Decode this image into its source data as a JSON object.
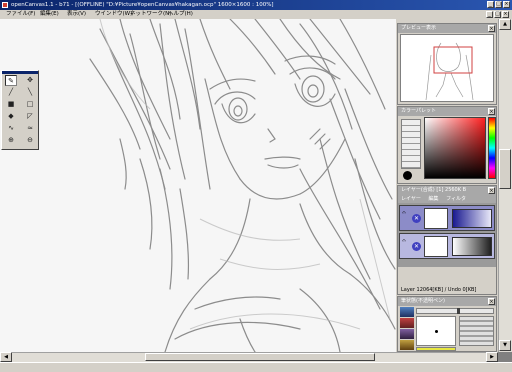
{
  "window": {
    "title": "openCanvas1.1 - b71 - [(OFFLINE) \"D:¥Picture¥openCanvas¥hakagan.ocp\" 1600×1600 : 100%]",
    "btn_min": "_",
    "btn_max": "□",
    "btn_close": "×"
  },
  "menu": {
    "items": [
      "ファイル(F)",
      "編集(E)",
      "表示(V)",
      "ウインドウ(W)",
      "ネットワーク(N)",
      "ヘルプ(H)"
    ]
  },
  "panels": {
    "preview": {
      "title": "プレビュー表示",
      "close": "×"
    },
    "color": {
      "title": "カラーパレット",
      "close": "×",
      "selected_color": "#cc3333"
    },
    "layers": {
      "title": "レイヤー(合成) [1] 2560K B",
      "close": "×",
      "tabs": [
        "レイヤー",
        "編集",
        "フィルタ"
      ],
      "status": "Layer 12064[KB] / Undo 0[KB]"
    },
    "brush": {
      "title": "筆状態(不透明ペン)",
      "close": "×"
    }
  },
  "colors": {
    "titlebar": "#0a246a",
    "panel": "#d4d0c8",
    "layer_selected": "#8c8cc8",
    "canvas": "#f6f6f6",
    "sketch": "#7a7a7a"
  }
}
